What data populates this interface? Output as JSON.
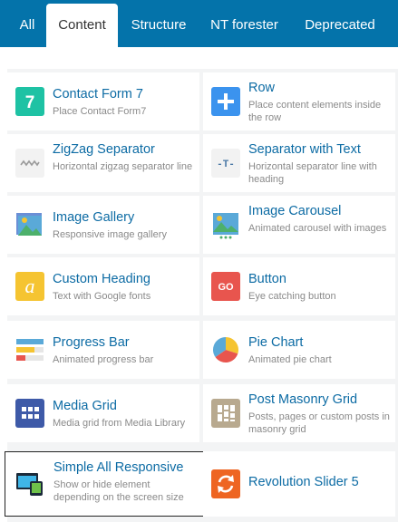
{
  "tabs": [
    {
      "label": "All"
    },
    {
      "label": "Content"
    },
    {
      "label": "Structure"
    },
    {
      "label": "NT forester"
    },
    {
      "label": "Deprecated"
    }
  ],
  "active_tab": "Content",
  "elements": [
    {
      "title": "Contact Form 7",
      "desc": "Place Contact Form7",
      "icon": "contact-form-7-icon"
    },
    {
      "title": "Row",
      "desc": "Place content elements inside the row",
      "icon": "plus-icon"
    },
    {
      "title": "ZigZag Separator",
      "desc": "Horizontal zigzag separator line",
      "icon": "zigzag-icon"
    },
    {
      "title": "Separator with Text",
      "desc": "Horizontal separator line with heading",
      "icon": "separator-text-icon",
      "icon_text": "-T-"
    },
    {
      "title": "Image Gallery",
      "desc": "Responsive image gallery",
      "icon": "image-gallery-icon"
    },
    {
      "title": "Image Carousel",
      "desc": "Animated carousel with images",
      "icon": "image-carousel-icon"
    },
    {
      "title": "Custom Heading",
      "desc": "Text with Google fonts",
      "icon": "custom-heading-icon",
      "icon_text": "a"
    },
    {
      "title": "Button",
      "desc": "Eye catching button",
      "icon": "button-icon",
      "icon_text": "GO"
    },
    {
      "title": "Progress Bar",
      "desc": "Animated progress bar",
      "icon": "progress-bar-icon"
    },
    {
      "title": "Pie Chart",
      "desc": "Animated pie chart",
      "icon": "pie-chart-icon"
    },
    {
      "title": "Media Grid",
      "desc": "Media grid from Media Library",
      "icon": "media-grid-icon"
    },
    {
      "title": "Post Masonry Grid",
      "desc": "Posts, pages or custom posts in masonry grid",
      "icon": "masonry-grid-icon"
    },
    {
      "title": "Simple All Responsive",
      "desc": "Show or hide element depending on the screen size",
      "icon": "responsive-icon"
    },
    {
      "title": "Revolution Slider 5",
      "desc": "",
      "icon": "revolution-slider-icon"
    }
  ],
  "colors": {
    "tab_bar": "#0473aa",
    "title": "#0c6ba4",
    "description": "#8a8a8a",
    "grid_background": "#f3f4f5"
  }
}
